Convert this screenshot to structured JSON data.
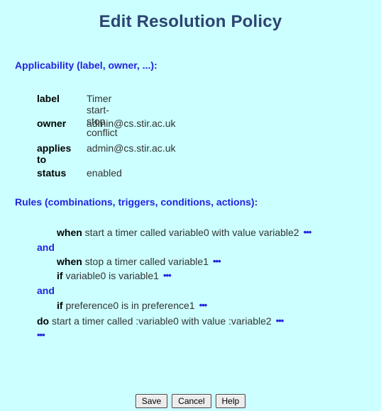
{
  "title": "Edit Resolution Policy",
  "applicability": {
    "heading": "Applicability (label, owner, ...):",
    "rows": [
      {
        "key": "label",
        "value": "Timer start-stop conflict"
      },
      {
        "key": "owner",
        "value": "admin@cs.stir.ac.uk"
      },
      {
        "key": "applies to",
        "value": "admin@cs.stir.ac.uk"
      },
      {
        "key": "status",
        "value": "enabled"
      }
    ]
  },
  "rules": {
    "heading": "Rules (combinations, triggers, conditions, actions):",
    "lines": [
      {
        "kw": "when",
        "text": " start a timer called variable0 with value variable2",
        "dots": "•••"
      },
      {
        "kw": "and",
        "text": "",
        "dots": ""
      },
      {
        "kw": "when",
        "text": " stop a timer called variable1",
        "dots": "•••"
      },
      {
        "kw": "if",
        "text": " variable0 is variable1",
        "dots": "•••"
      },
      {
        "kw": "and",
        "text": "",
        "dots": ""
      },
      {
        "kw": "if",
        "text": " preference0 is in preference1",
        "dots": "•••"
      },
      {
        "kw": "do",
        "text": " start a timer called :variable0 with value :variable2",
        "dots": "•••"
      },
      {
        "kw": "",
        "text": "",
        "dots": "•••"
      }
    ]
  },
  "buttons": {
    "save": "Save",
    "cancel": "Cancel",
    "help": "Help"
  },
  "colors": {
    "background": "#ccffff",
    "heading": "#2323e0",
    "title": "#2c4470"
  }
}
